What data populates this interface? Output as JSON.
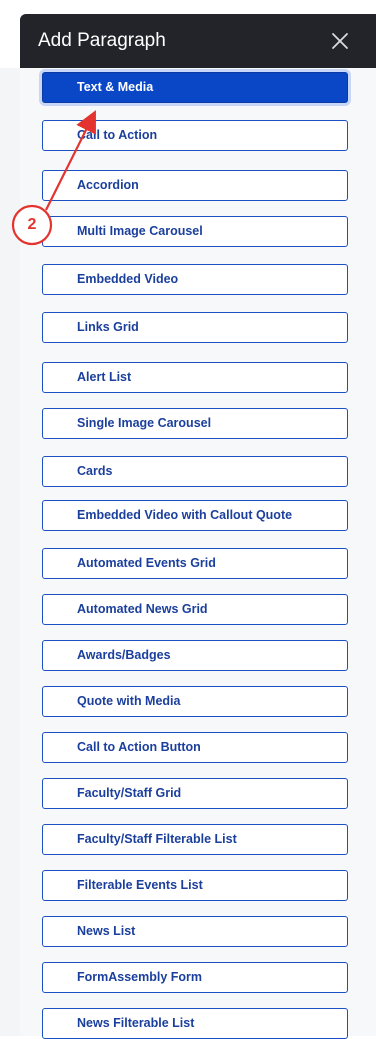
{
  "dialog": {
    "title": "Add Paragraph",
    "close_icon": "close-icon"
  },
  "paragraph_types": [
    {
      "label": "Text & Media",
      "selected": true
    },
    {
      "label": "Call to Action"
    },
    {
      "label": "Accordion"
    },
    {
      "label": "Multi Image Carousel"
    },
    {
      "label": "Embedded Video"
    },
    {
      "label": "Links Grid"
    },
    {
      "label": "Alert List"
    },
    {
      "label": "Single Image Carousel"
    },
    {
      "label": "Cards"
    },
    {
      "label": "Embedded Video with Callout Quote"
    },
    {
      "label": "Automated Events Grid"
    },
    {
      "label": "Automated News Grid"
    },
    {
      "label": "Awards/Badges"
    },
    {
      "label": "Quote with Media"
    },
    {
      "label": "Call to Action Button"
    },
    {
      "label": "Faculty/Staff Grid"
    },
    {
      "label": "Faculty/Staff Filterable List"
    },
    {
      "label": "Filterable Events List"
    },
    {
      "label": "News List"
    },
    {
      "label": "FormAssembly Form"
    },
    {
      "label": "News Filterable List"
    }
  ],
  "annotation": {
    "step_number": "2",
    "color": "#e3342f"
  },
  "colors": {
    "header_bg": "#232429",
    "button_border": "#1b4fc4",
    "button_text": "#1b3f9c",
    "selected_bg": "#0a47c7"
  }
}
